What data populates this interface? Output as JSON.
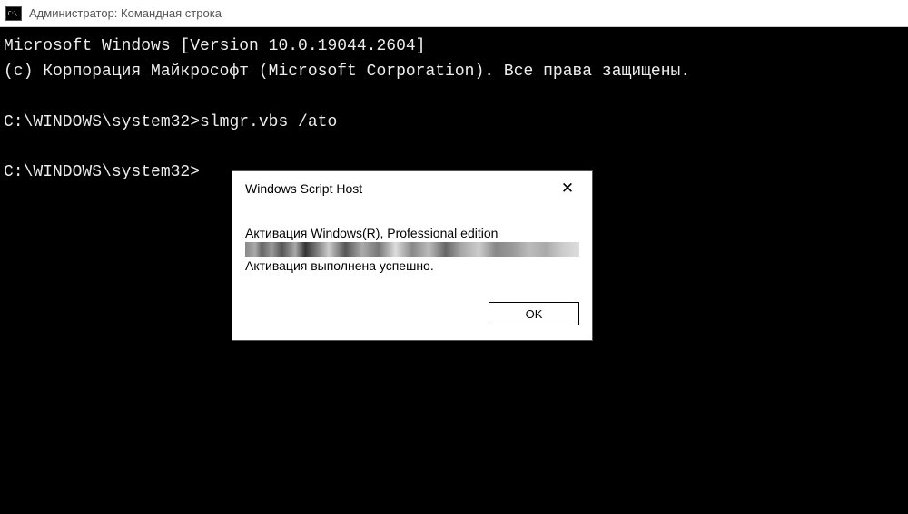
{
  "titlebar": {
    "icon_text": "C:\\.",
    "title": "Администратор: Командная строка"
  },
  "console": {
    "line1": "Microsoft Windows [Version 10.0.19044.2604]",
    "line2": "(c) Корпорация Майкрософт (Microsoft Corporation). Все права защищены.",
    "line3": "",
    "line4": "C:\\WINDOWS\\system32>slmgr.vbs /ato",
    "line5": "",
    "line6": "C:\\WINDOWS\\system32>"
  },
  "dialog": {
    "title": "Windows Script Host",
    "close_glyph": "✕",
    "message_line1": "Активация Windows(R), Professional edition",
    "message_line2": "Активация выполнена успешно.",
    "ok_label": "OK"
  }
}
